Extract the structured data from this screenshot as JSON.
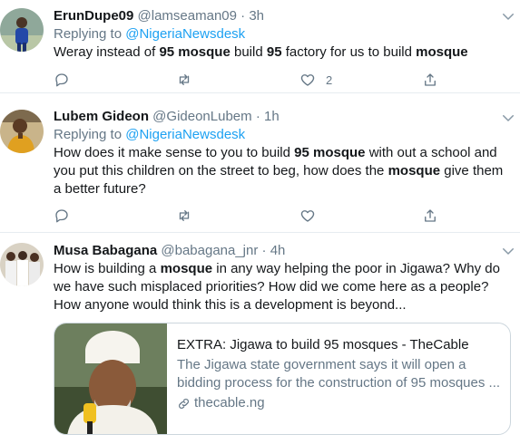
{
  "tweets": [
    {
      "name": "ErunDupe09",
      "handle": "@lamseaman09",
      "dot": "·",
      "time": "3h",
      "replying_prefix": "Replying to ",
      "replying_to": "@NigeriaNewsdesk",
      "text": [
        {
          "t": "Weray instead of "
        },
        {
          "t": "95 mosque",
          "b": true
        },
        {
          "t": " build "
        },
        {
          "t": "95",
          "b": true
        },
        {
          "t": " factory for us to build "
        },
        {
          "t": "mosque",
          "b": true
        }
      ],
      "reply_count": "",
      "retweet_count": "",
      "like_count": "2"
    },
    {
      "name": "Lubem Gideon",
      "handle": "@GideonLubem",
      "dot": "·",
      "time": "1h",
      "replying_prefix": "Replying to ",
      "replying_to": "@NigeriaNewsdesk",
      "text": [
        {
          "t": "How does it make sense to you to build "
        },
        {
          "t": "95 mosque",
          "b": true
        },
        {
          "t": " with out a school and you put this children on the street to beg, how does the "
        },
        {
          "t": "mosque",
          "b": true
        },
        {
          "t": " give them a better future?"
        }
      ],
      "reply_count": "",
      "retweet_count": "",
      "like_count": ""
    },
    {
      "name": "Musa Babagana",
      "handle": "@babagana_jnr",
      "dot": "·",
      "time": "4h",
      "text": [
        {
          "t": "How is building a "
        },
        {
          "t": "mosque",
          "b": true
        },
        {
          "t": " in any way helping the poor in Jigawa? Why do we have such misplaced priorities? How did we come here as a people? How anyone would think this is a development is beyond..."
        }
      ],
      "card": {
        "title": "EXTRA: Jigawa to build 95 mosques - TheCable",
        "description": "The Jigawa state government says it will open a bidding process for the construction of 95 mosques ...",
        "link": "thecable.ng"
      }
    }
  ],
  "icons": {
    "reply": "reply-icon",
    "retweet": "retweet-icon",
    "like": "heart-icon",
    "share": "share-icon",
    "caret": "chevron-down-icon",
    "link": "link-icon"
  },
  "colors": {
    "accent": "#1da1f2",
    "secondary_text": "#657786",
    "primary_text": "#14171a",
    "divider": "#e6ecf0"
  }
}
